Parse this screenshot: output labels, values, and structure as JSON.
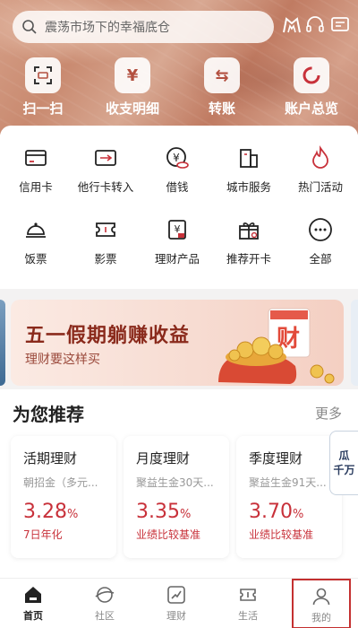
{
  "header": {
    "search_placeholder": "震荡市场下的幸福底仓",
    "quick_actions": [
      {
        "label": "扫一扫",
        "icon": "scan-icon"
      },
      {
        "label": "收支明细",
        "icon": "yuan-icon"
      },
      {
        "label": "转账",
        "icon": "transfer-icon"
      },
      {
        "label": "账户总览",
        "icon": "pie-chart-icon"
      }
    ]
  },
  "services": [
    {
      "label": "信用卡",
      "icon": "credit-card-icon"
    },
    {
      "label": "他行卡转入",
      "icon": "card-transfer-icon"
    },
    {
      "label": "借钱",
      "icon": "coin-icon"
    },
    {
      "label": "城市服务",
      "icon": "building-icon"
    },
    {
      "label": "热门活动",
      "icon": "flame-icon"
    },
    {
      "label": "饭票",
      "icon": "dish-icon"
    },
    {
      "label": "影票",
      "icon": "ticket-icon"
    },
    {
      "label": "理财产品",
      "icon": "finance-doc-icon"
    },
    {
      "label": "推荐开卡",
      "icon": "gift-icon"
    },
    {
      "label": "全部",
      "icon": "more-icon"
    }
  ],
  "banner": {
    "title": "五一假期躺赚收益",
    "subtitle": "理财要这样买",
    "badge": "财"
  },
  "recommend": {
    "title": "为您推荐",
    "more": "更多",
    "products": [
      {
        "name": "活期理财",
        "desc": "朝招金（多元...",
        "rate": "3.28",
        "unit": "%",
        "note": "7日年化"
      },
      {
        "name": "月度理财",
        "desc": "聚益生金30天...",
        "rate": "3.35",
        "unit": "%",
        "note": "业绩比较基准"
      },
      {
        "name": "季度理财",
        "desc": "聚益生金91天...",
        "rate": "3.70",
        "unit": "%",
        "note": "业绩比较基准"
      }
    ],
    "side_tag": [
      "瓜",
      "千万"
    ]
  },
  "tabbar": [
    {
      "label": "首页",
      "icon": "home-icon",
      "active": true
    },
    {
      "label": "社区",
      "icon": "community-icon"
    },
    {
      "label": "理财",
      "icon": "chart-icon"
    },
    {
      "label": "生活",
      "icon": "life-icon"
    },
    {
      "label": "我的",
      "icon": "user-icon"
    }
  ],
  "colors": {
    "accent": "#c8313a",
    "header": "#c98a70",
    "banner_title": "#8a2a1c"
  }
}
